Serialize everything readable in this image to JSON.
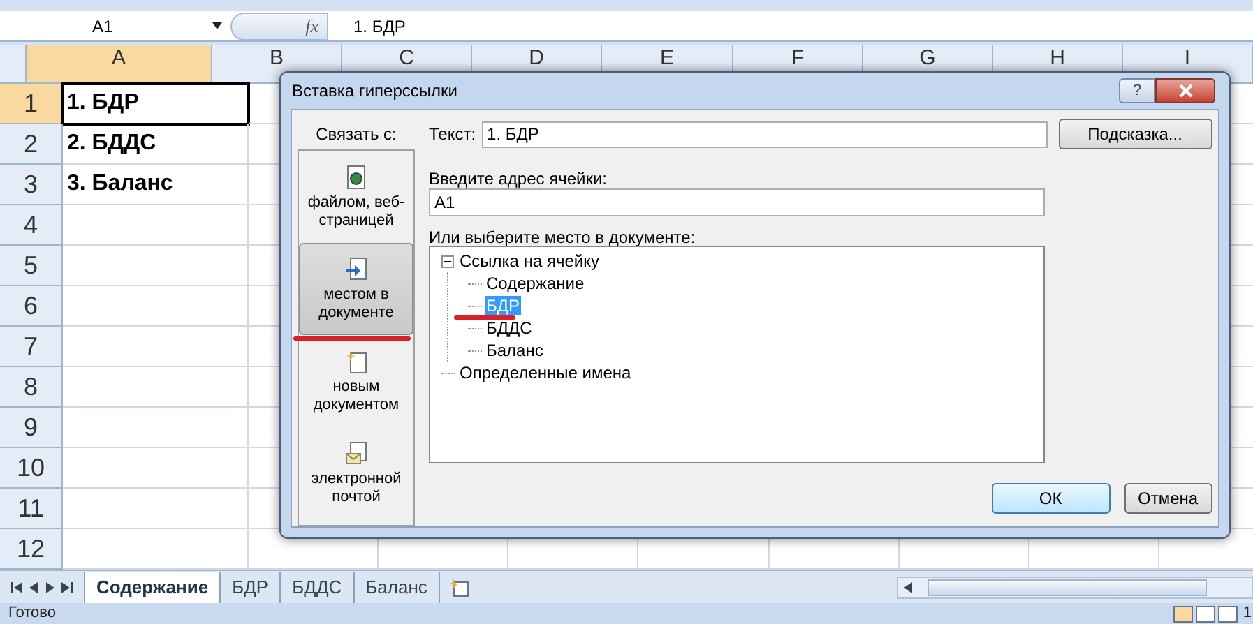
{
  "formula_bar": {
    "name_box": "A1",
    "fx": "fx",
    "formula": "1. БДР"
  },
  "columns": [
    {
      "label": "A",
      "selected": true
    },
    {
      "label": "B",
      "selected": false
    },
    {
      "label": "C",
      "selected": false
    },
    {
      "label": "D",
      "selected": false
    },
    {
      "label": "E",
      "selected": false
    },
    {
      "label": "F",
      "selected": false
    },
    {
      "label": "G",
      "selected": false
    },
    {
      "label": "H",
      "selected": false
    },
    {
      "label": "I",
      "selected": false
    }
  ],
  "rows": [
    {
      "label": "1",
      "selected": true,
      "cell_a": "1. БДР"
    },
    {
      "label": "2",
      "selected": false,
      "cell_a": "2. БДДС"
    },
    {
      "label": "3",
      "selected": false,
      "cell_a": "3. Баланс"
    },
    {
      "label": "4",
      "selected": false
    },
    {
      "label": "5",
      "selected": false
    },
    {
      "label": "6",
      "selected": false
    },
    {
      "label": "7",
      "selected": false
    },
    {
      "label": "8",
      "selected": false
    },
    {
      "label": "9",
      "selected": false
    },
    {
      "label": "10",
      "selected": false
    },
    {
      "label": "11",
      "selected": false
    },
    {
      "label": "12",
      "selected": false
    }
  ],
  "dialog": {
    "title": "Вставка гиперссылки",
    "help": "?",
    "link_to_label": "Связать с:",
    "link_targets": [
      {
        "label": "файлом, веб-страницей",
        "kind": "file",
        "selected": false
      },
      {
        "label": "местом в документе",
        "kind": "place",
        "selected": true
      },
      {
        "label": "новым документом",
        "kind": "new",
        "selected": false
      },
      {
        "label": "электронной почтой",
        "kind": "mail",
        "selected": false
      }
    ],
    "text_label": "Текст:",
    "text_value": "1. БДР",
    "tip_button": "Подсказка...",
    "cell_label": "Введите адрес ячейки:",
    "cell_value": "A1",
    "place_label": "Или выберите место в документе:",
    "tree": [
      {
        "label": "Ссылка на ячейку",
        "expanded": true,
        "selected": false,
        "children": [
          {
            "label": "Содержание",
            "selected": false
          },
          {
            "label": "БДР",
            "selected": true
          },
          {
            "label": "БДДС",
            "selected": false
          },
          {
            "label": "Баланс",
            "selected": false
          }
        ]
      },
      {
        "label": "Определенные имена",
        "selected": false
      }
    ],
    "ok": "ОК",
    "cancel": "Отмена"
  },
  "sheet_tabs": [
    {
      "label": "Содержание",
      "selected": true
    },
    {
      "label": "БДР",
      "selected": false
    },
    {
      "label": "БДДС",
      "selected": false
    },
    {
      "label": "Баланс",
      "selected": false
    }
  ],
  "status_bar": {
    "status": "Готово",
    "zoom": "1"
  }
}
